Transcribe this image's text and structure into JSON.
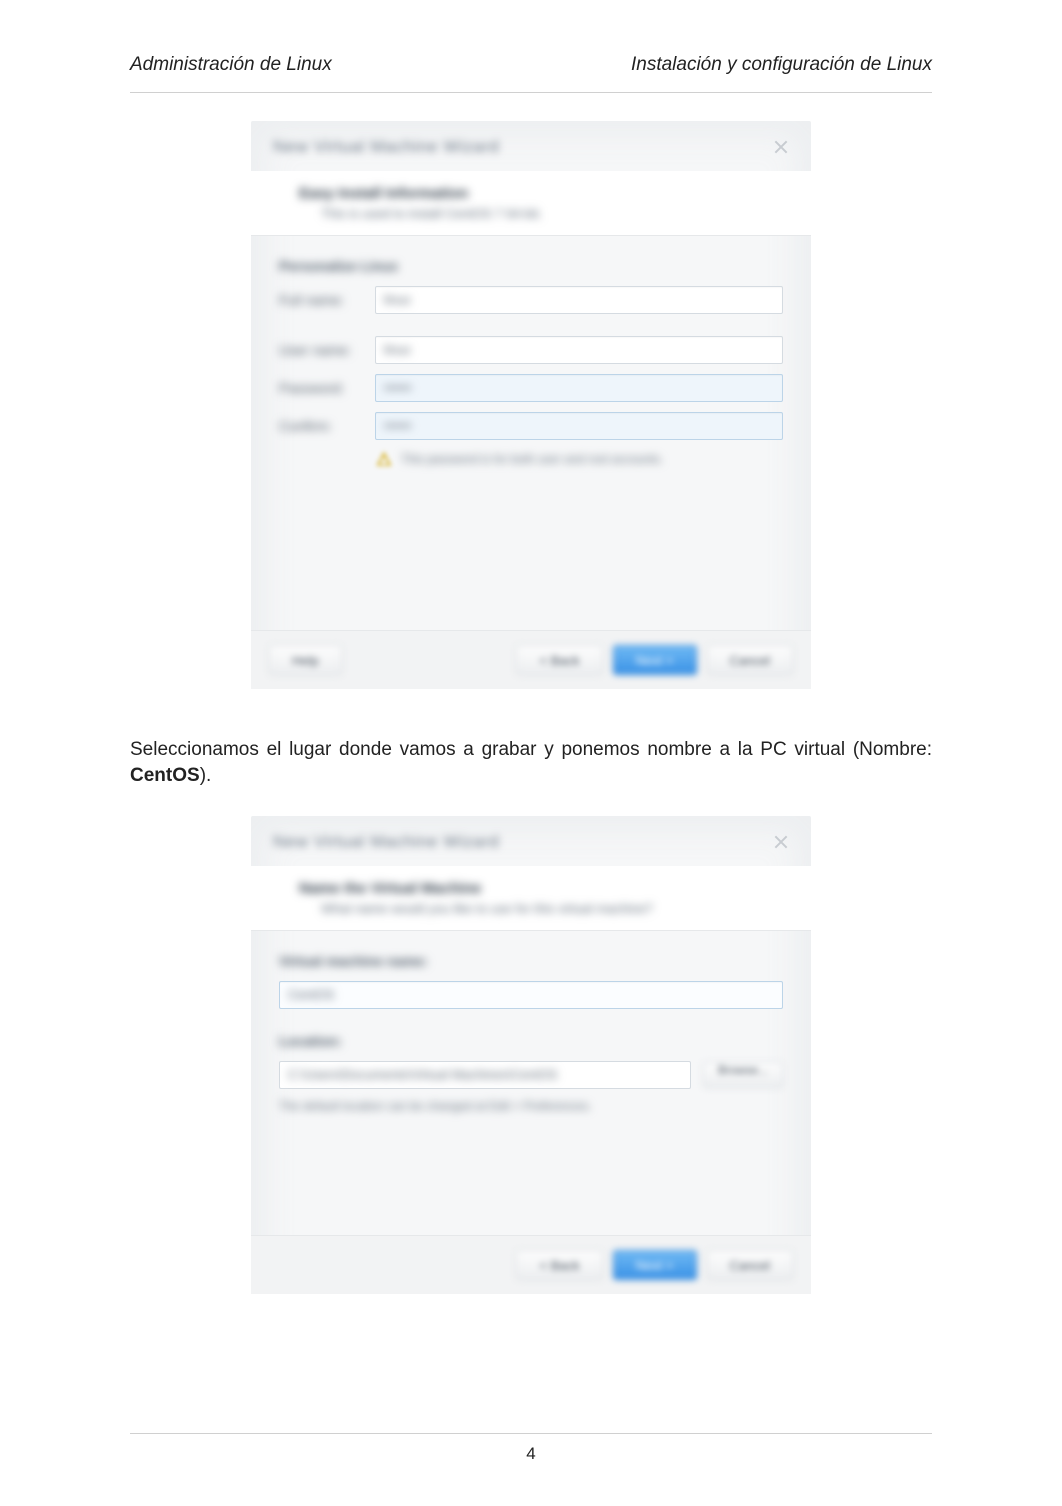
{
  "header": {
    "left": "Administración de Linux",
    "right": "Instalación y configuración de Linux"
  },
  "between_text": {
    "line": "Seleccionamos el lugar donde vamos a grabar y ponemos nombre a la PC virtual (Nombre: ",
    "bold": "CentOS",
    "tail": ")."
  },
  "page_number": "4",
  "wizard1": {
    "title": "New Virtual Machine Wizard",
    "banner_title": "Easy Install Information",
    "banner_sub": "This is used to install CentOS 7 64-bit.",
    "section": "Personalize Linux",
    "fields": {
      "fullname": {
        "label": "Full name:",
        "value": "linux"
      },
      "username": {
        "label": "User name:",
        "value": "linux"
      },
      "password": {
        "label": "Password:",
        "value": "••••••"
      },
      "confirm": {
        "label": "Confirm:",
        "value": "••••••"
      }
    },
    "warning": "This password is for both user and root accounts.",
    "buttons": {
      "help": "Help",
      "back": "< Back",
      "next": "Next >",
      "cancel": "Cancel"
    }
  },
  "wizard2": {
    "title": "New Virtual Machine Wizard",
    "banner_title": "Name the Virtual Machine",
    "banner_sub": "What name would you like to use for this virtual machine?",
    "name_label": "Virtual machine name:",
    "name_value": "CentOS",
    "location_label": "Location:",
    "location_value": "C:\\Users\\Documents\\Virtual Machines\\CentOS",
    "browse": "Browse...",
    "hint": "The default location can be changed at Edit > Preferences.",
    "buttons": {
      "back": "< Back",
      "next": "Next >",
      "cancel": "Cancel"
    }
  }
}
